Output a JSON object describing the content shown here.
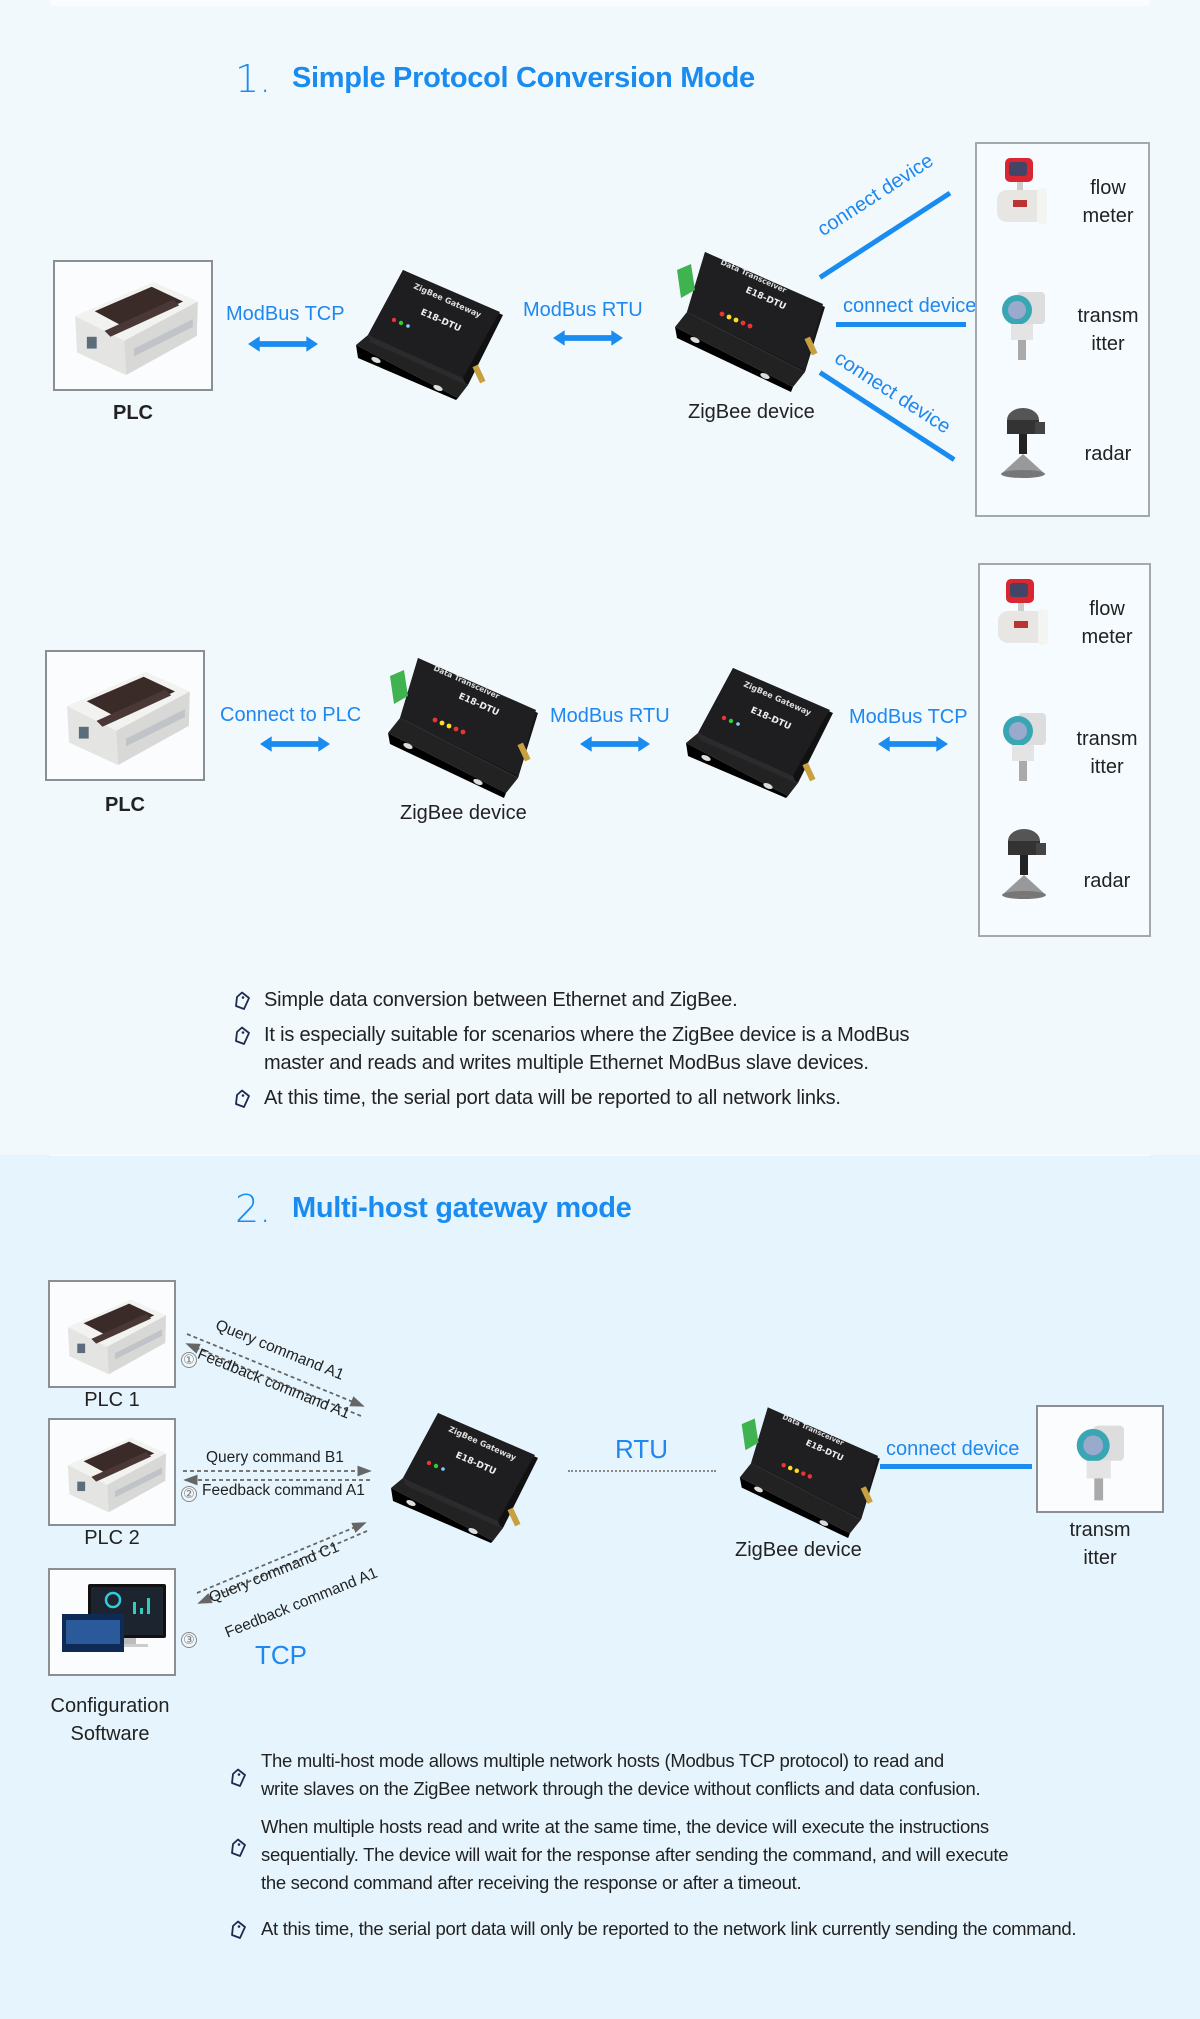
{
  "section1": {
    "number": "1.",
    "title": "Simple Protocol Conversion Mode",
    "diagram1": {
      "plc_label": "PLC",
      "link1_label": "ModBus  TCP",
      "gateway_name": "ZigBee Gateway",
      "link2_label": "ModBus  RTU",
      "device_label": "ZigBee device",
      "device_name": "Data Transceiver",
      "brand": "E18-DTU",
      "connect_labels": [
        "connect device",
        "connect device",
        "connect device"
      ],
      "sensors": [
        {
          "line1": "flow",
          "line2": "meter"
        },
        {
          "line1": "transm",
          "line2": "itter"
        },
        {
          "line1": "radar",
          "line2": ""
        }
      ]
    },
    "diagram2": {
      "plc_label": "PLC",
      "link1_label": "Connect to PLC",
      "device_label": "ZigBee device",
      "link2_label": "ModBus  RTU",
      "link3_label": "ModBus  TCP",
      "sensors": [
        {
          "line1": "flow",
          "line2": "meter"
        },
        {
          "line1": "transm",
          "line2": "itter"
        },
        {
          "line1": "radar",
          "line2": ""
        }
      ]
    },
    "bullets": [
      {
        "lines": [
          "Simple data conversion between Ethernet and ZigBee."
        ]
      },
      {
        "lines": [
          "It is especially suitable for scenarios where the ZigBee device is a ModBus",
          "master and reads and writes multiple Ethernet ModBus slave devices."
        ]
      },
      {
        "lines": [
          "At this time, the serial port data will be reported to all network links."
        ]
      }
    ]
  },
  "section2": {
    "number": "2.",
    "title": "Multi-host gateway mode",
    "hosts": [
      {
        "label": "PLC 1",
        "step": "①",
        "query": "Query command A1",
        "feedback": "Feedback command A1"
      },
      {
        "label": "PLC 2",
        "step": "②",
        "query": "Query command B1",
        "feedback": "Feedback command A1"
      },
      {
        "label_line1": "Configuration",
        "label_line2": "Software",
        "step": "③",
        "query": "Query command C1",
        "feedback": "Feedback command A1"
      }
    ],
    "tcp_label": "TCP",
    "rtu_label": "RTU",
    "device_label": "ZigBee device",
    "connect_label": "connect device",
    "sensor": {
      "line1": "transm",
      "line2": "itter"
    },
    "bullets": [
      {
        "lines": [
          "The multi-host mode allows multiple network hosts (Modbus TCP protocol) to read and",
          "write slaves on the ZigBee network through the device without conflicts and data confusion."
        ]
      },
      {
        "lines": [
          "When multiple hosts read and write at the same time, the device will execute the instructions",
          "sequentially. The device will wait for the response after sending the command, and will execute",
          "the second command after receiving the response or after a timeout."
        ]
      },
      {
        "lines": [
          "At this time, the serial port data will only be reported to the network link currently sending the command."
        ]
      }
    ]
  },
  "colors": {
    "accent": "#1a8cf0",
    "background_top": "#f1f9fd",
    "background_bottom": "#e6f5fd",
    "device_body": "#1c1c1e"
  }
}
